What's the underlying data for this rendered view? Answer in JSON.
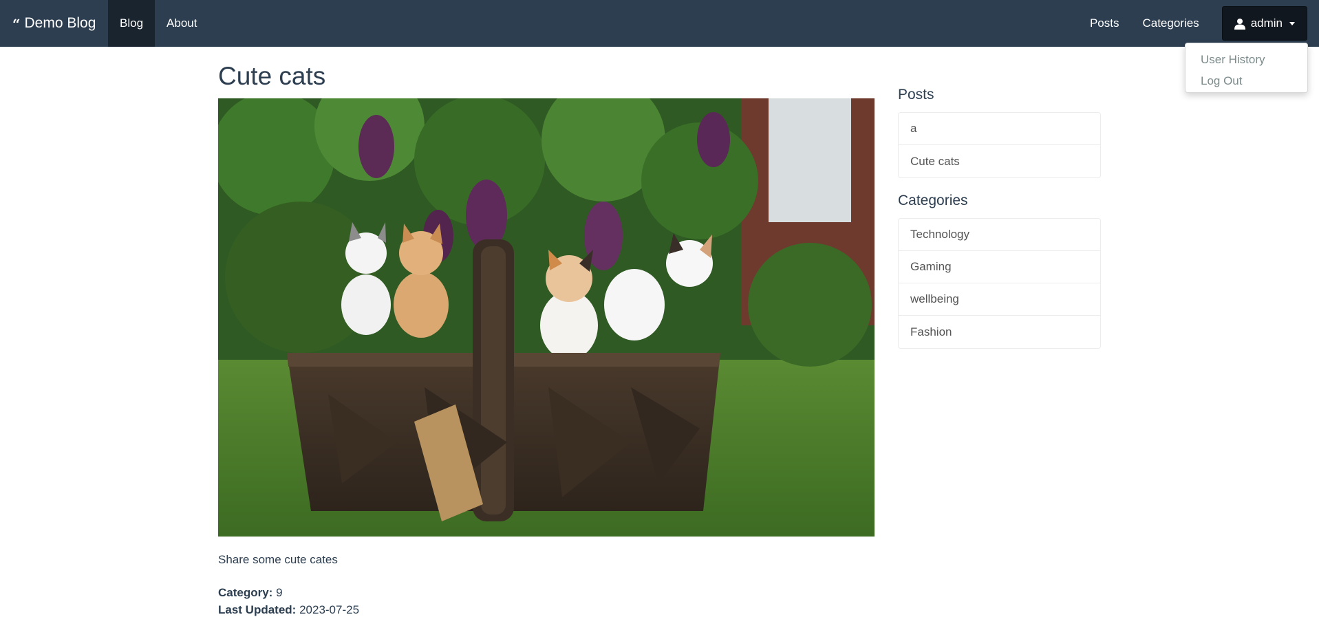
{
  "navbar": {
    "brand": "Demo Blog",
    "left_items": [
      {
        "label": "Blog",
        "active": true
      },
      {
        "label": "About",
        "active": false
      }
    ],
    "right_links": [
      "Posts",
      "Categories"
    ],
    "user_label": "admin",
    "user_menu": [
      "User History",
      "Log Out"
    ]
  },
  "post": {
    "title": "Cute cats",
    "body": "Share some cute cates",
    "category_label": "Category:",
    "category_value": "9",
    "updated_label": "Last Updated:",
    "updated_value": "2023-07-25"
  },
  "sidebar": {
    "posts_heading": "Posts",
    "posts": [
      "a",
      "Cute cats"
    ],
    "categories_heading": "Categories",
    "categories": [
      "Technology",
      "Gaming",
      "wellbeing",
      "Fashion"
    ]
  },
  "colors": {
    "navbar_bg": "#2c3e50",
    "navbar_active": "#1a242f",
    "text_primary": "#2c3e50",
    "dropdown_text": "#7b8a8b"
  },
  "icons": {
    "brand": "quote-icon",
    "user": "user-icon",
    "dropdown": "caret-down-icon"
  }
}
